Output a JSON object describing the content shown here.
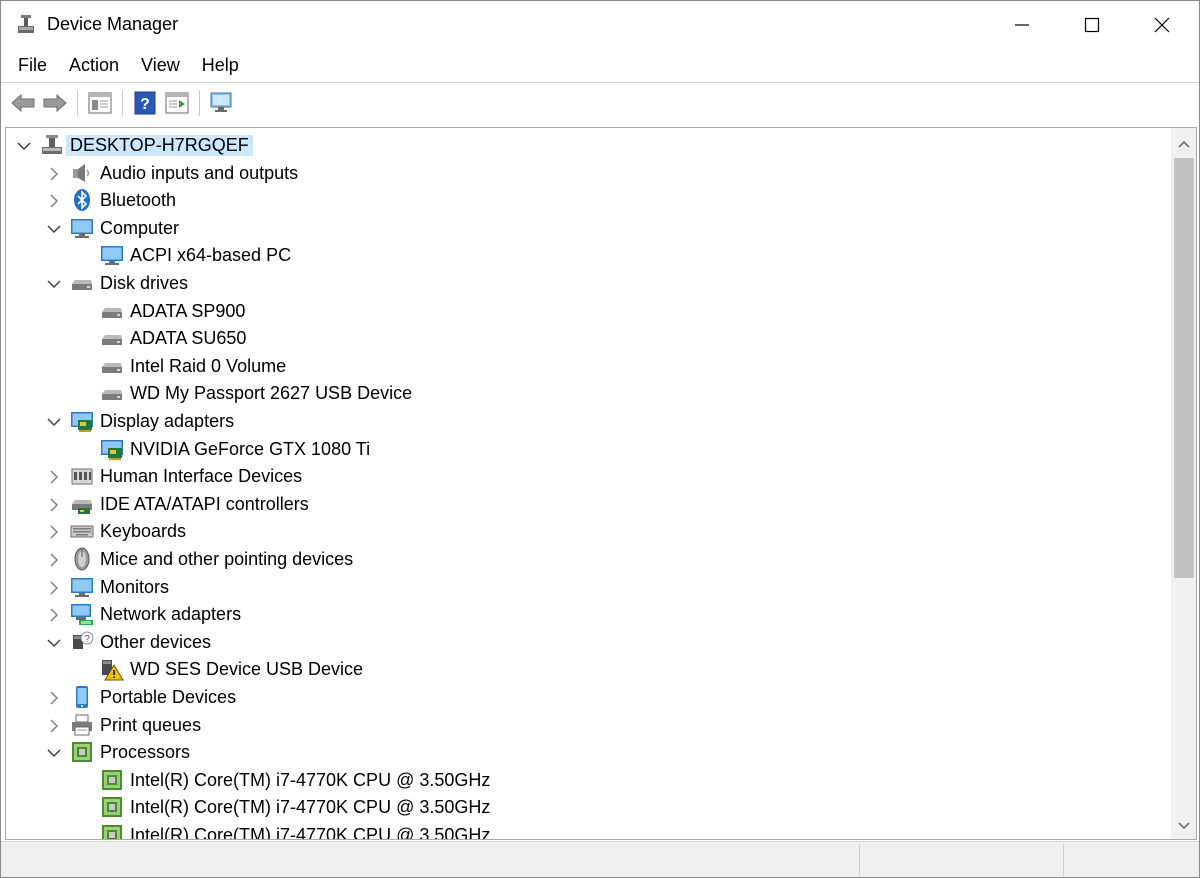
{
  "window": {
    "title": "Device Manager"
  },
  "menu": [
    "File",
    "Action",
    "View",
    "Help"
  ],
  "toolbar_icons": [
    "back-arrow-icon",
    "forward-arrow-icon",
    "properties-panel-icon",
    "help-icon",
    "update-driver-icon",
    "scan-hardware-icon"
  ],
  "tree": [
    {
      "label": "DESKTOP-H7RGQEF",
      "level": 0,
      "expander": "expanded",
      "icon": "computer-root-icon",
      "selected": true
    },
    {
      "label": "Audio inputs and outputs",
      "level": 1,
      "expander": "collapsed",
      "icon": "speaker-icon"
    },
    {
      "label": "Bluetooth",
      "level": 1,
      "expander": "collapsed",
      "icon": "bluetooth-icon"
    },
    {
      "label": "Computer",
      "level": 1,
      "expander": "expanded",
      "icon": "monitor-icon"
    },
    {
      "label": "ACPI x64-based PC",
      "level": 2,
      "expander": "none",
      "icon": "monitor-icon"
    },
    {
      "label": "Disk drives",
      "level": 1,
      "expander": "expanded",
      "icon": "disk-drive-icon"
    },
    {
      "label": "ADATA SP900",
      "level": 2,
      "expander": "none",
      "icon": "disk-drive-icon"
    },
    {
      "label": "ADATA SU650",
      "level": 2,
      "expander": "none",
      "icon": "disk-drive-icon"
    },
    {
      "label": "Intel Raid 0 Volume",
      "level": 2,
      "expander": "none",
      "icon": "disk-drive-icon"
    },
    {
      "label": "WD My Passport 2627 USB Device",
      "level": 2,
      "expander": "none",
      "icon": "disk-drive-icon"
    },
    {
      "label": "Display adapters",
      "level": 1,
      "expander": "expanded",
      "icon": "display-adapter-icon"
    },
    {
      "label": "NVIDIA GeForce GTX 1080 Ti",
      "level": 2,
      "expander": "none",
      "icon": "display-adapter-icon"
    },
    {
      "label": "Human Interface Devices",
      "level": 1,
      "expander": "collapsed",
      "icon": "hid-icon"
    },
    {
      "label": "IDE ATA/ATAPI controllers",
      "level": 1,
      "expander": "collapsed",
      "icon": "ide-controller-icon"
    },
    {
      "label": "Keyboards",
      "level": 1,
      "expander": "collapsed",
      "icon": "keyboard-icon"
    },
    {
      "label": "Mice and other pointing devices",
      "level": 1,
      "expander": "collapsed",
      "icon": "mouse-icon"
    },
    {
      "label": "Monitors",
      "level": 1,
      "expander": "collapsed",
      "icon": "monitor-icon"
    },
    {
      "label": "Network adapters",
      "level": 1,
      "expander": "collapsed",
      "icon": "network-adapter-icon"
    },
    {
      "label": "Other devices",
      "level": 1,
      "expander": "expanded",
      "icon": "unknown-device-icon"
    },
    {
      "label": "WD SES Device USB Device",
      "level": 2,
      "expander": "none",
      "icon": "warning-device-icon"
    },
    {
      "label": "Portable Devices",
      "level": 1,
      "expander": "collapsed",
      "icon": "portable-device-icon"
    },
    {
      "label": "Print queues",
      "level": 1,
      "expander": "collapsed",
      "icon": "printer-icon"
    },
    {
      "label": "Processors",
      "level": 1,
      "expander": "expanded",
      "icon": "processor-icon"
    },
    {
      "label": "Intel(R) Core(TM) i7-4770K CPU @ 3.50GHz",
      "level": 2,
      "expander": "none",
      "icon": "processor-icon"
    },
    {
      "label": "Intel(R) Core(TM) i7-4770K CPU @ 3.50GHz",
      "level": 2,
      "expander": "none",
      "icon": "processor-icon"
    },
    {
      "label": "Intel(R) Core(TM) i7-4770K CPU @ 3.50GHz",
      "level": 2,
      "expander": "none",
      "icon": "processor-icon"
    }
  ],
  "colors": {
    "selection": "#cce8ff",
    "window_border": "#8a8a8a",
    "scrollbar_track": "#f0f0f0",
    "scrollbar_thumb": "#c2c2c2",
    "statusbar": "#f0f0f0"
  }
}
